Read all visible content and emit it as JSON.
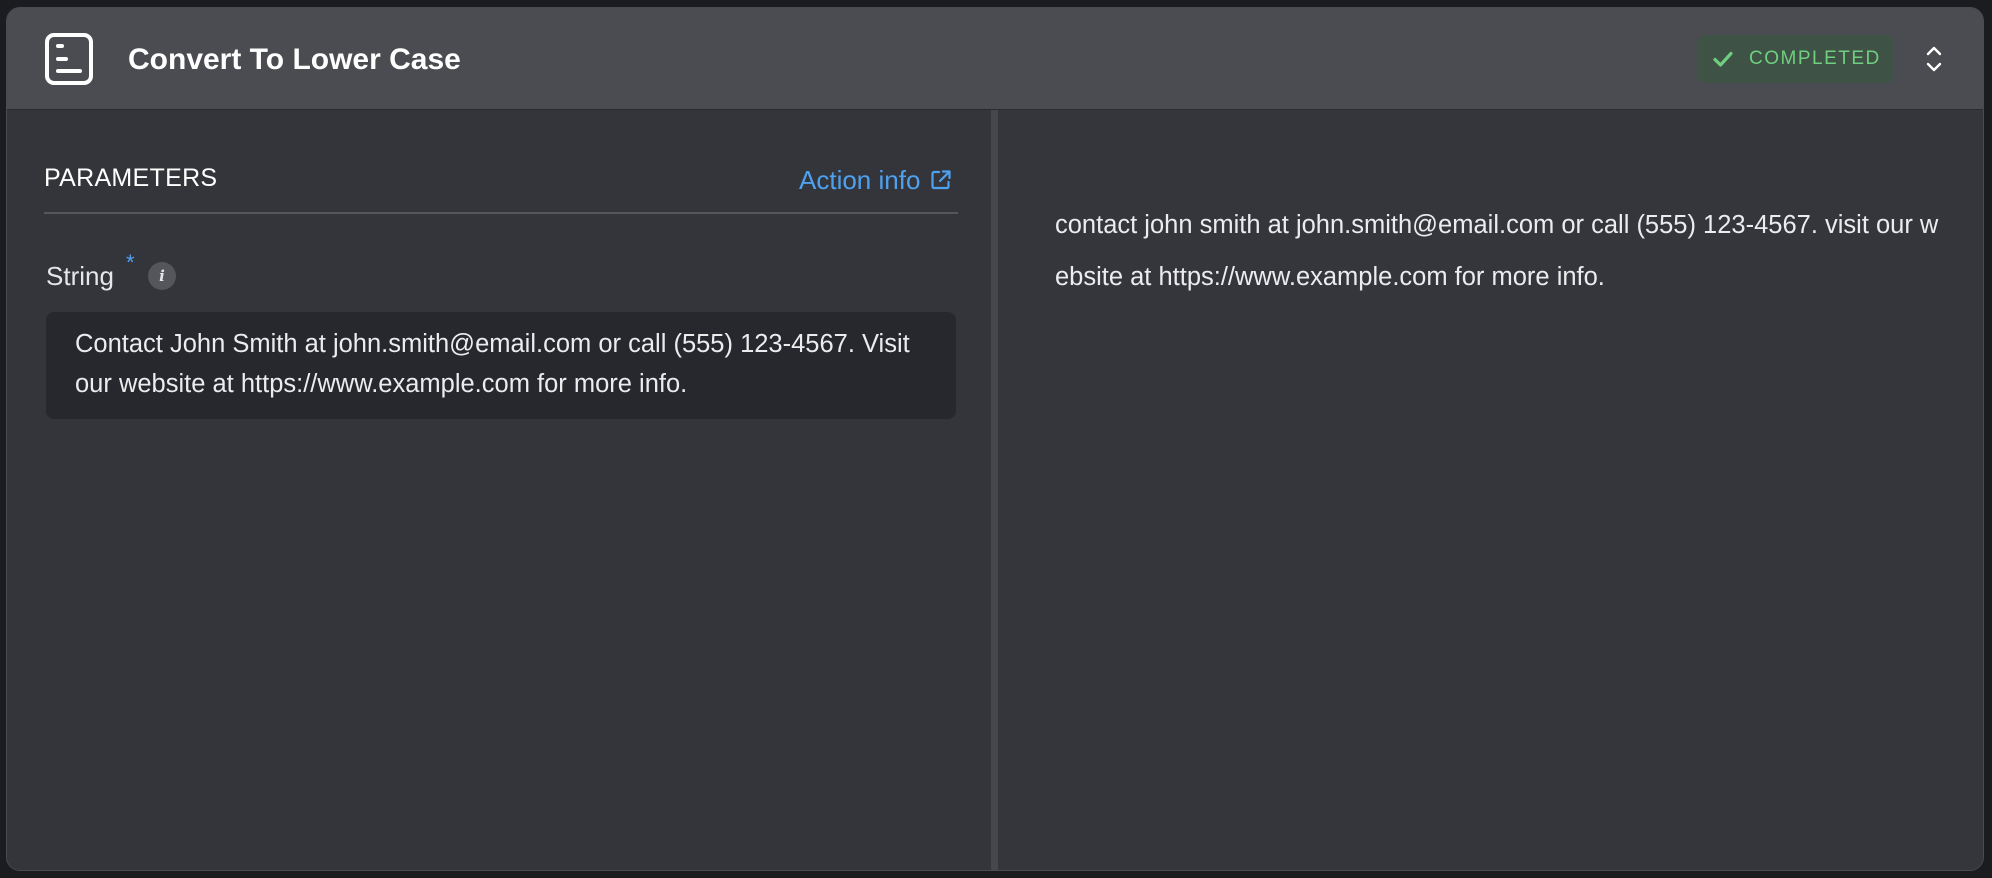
{
  "header": {
    "icon": "document-lines-icon",
    "title": "Convert To Lower Case",
    "status": {
      "label": "COMPLETED",
      "icon": "check-icon",
      "color": "#6fcf7f"
    },
    "expand_icon": "chevron-up-down-icon"
  },
  "parameters": {
    "title": "PARAMETERS",
    "action_info_label": "Action info",
    "action_info_icon": "external-link-icon",
    "accent_color": "#4ea1ef",
    "fields": [
      {
        "label": "String",
        "required_marker": "*",
        "info_icon_glyph": "i",
        "value": "Contact John Smith at john.smith@email.com or call (555) 123-4567. Visit our website at https://www.example.com for more info."
      }
    ]
  },
  "output": {
    "text": "contact john smith at john.smith@email.com or call (555) 123-4567. visit our website at https://www.example.com for more info."
  }
}
